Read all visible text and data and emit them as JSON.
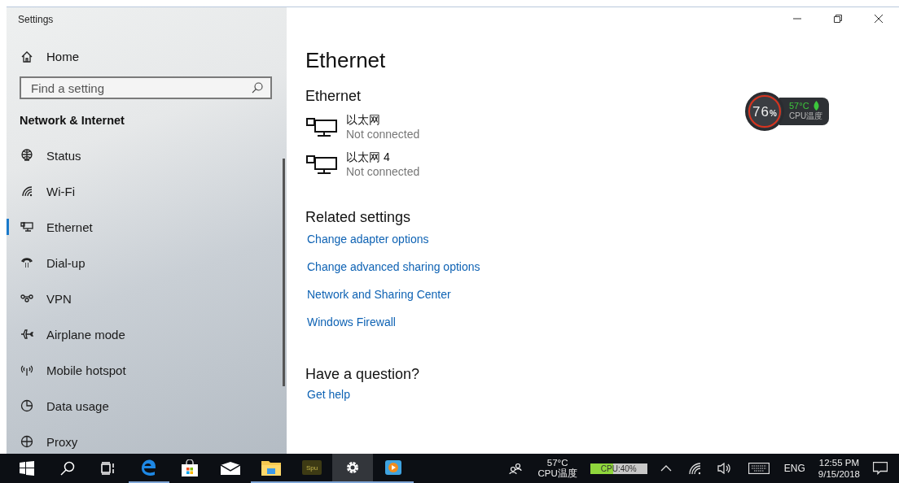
{
  "window": {
    "title": "Settings"
  },
  "sidebar": {
    "home": "Home",
    "search": {
      "placeholder": "Find a setting"
    },
    "section": "Network & Internet",
    "items": [
      {
        "kind": "status",
        "label": "Status",
        "selected": false
      },
      {
        "kind": "wifi",
        "label": "Wi-Fi",
        "selected": false
      },
      {
        "kind": "ethernet",
        "label": "Ethernet",
        "selected": true
      },
      {
        "kind": "dialup",
        "label": "Dial-up",
        "selected": false
      },
      {
        "kind": "vpn",
        "label": "VPN",
        "selected": false
      },
      {
        "kind": "airplane",
        "label": "Airplane mode",
        "selected": false
      },
      {
        "kind": "hotspot",
        "label": "Mobile hotspot",
        "selected": false
      },
      {
        "kind": "data",
        "label": "Data usage",
        "selected": false
      },
      {
        "kind": "proxy",
        "label": "Proxy",
        "selected": false
      }
    ]
  },
  "main": {
    "title": "Ethernet",
    "section": "Ethernet",
    "adapters": [
      {
        "name": "以太网",
        "status": "Not connected"
      },
      {
        "name": "以太网 4",
        "status": "Not connected"
      }
    ],
    "related_title": "Related settings",
    "links": [
      "Change adapter options",
      "Change advanced sharing options",
      "Network and Sharing Center",
      "Windows Firewall"
    ],
    "question_title": "Have a question?",
    "help_link": "Get help"
  },
  "cpu_widget": {
    "usage": "76",
    "unit": "%",
    "temp": "57°C",
    "label": "CPU温度"
  },
  "taskbar": {
    "apps": [
      {
        "kind": "start",
        "running": false,
        "active": false
      },
      {
        "kind": "search",
        "running": false,
        "active": false
      },
      {
        "kind": "taskview",
        "running": false,
        "active": false
      },
      {
        "kind": "edge",
        "running": true,
        "active": false
      },
      {
        "kind": "store",
        "running": false,
        "active": false
      },
      {
        "kind": "mail",
        "running": false,
        "active": false
      },
      {
        "kind": "explorer",
        "running": true,
        "active": false
      },
      {
        "kind": "spu",
        "running": true,
        "active": false,
        "text": "Spu"
      },
      {
        "kind": "settings",
        "running": true,
        "active": true
      },
      {
        "kind": "media",
        "running": true,
        "active": false
      }
    ],
    "temp": "57°C",
    "temp_label": "CPU温度",
    "cpu_meter": {
      "label": "CPU:40%",
      "level": 0.4
    },
    "language": "ENG",
    "time": "12:55 PM",
    "date": "9/15/2018"
  }
}
